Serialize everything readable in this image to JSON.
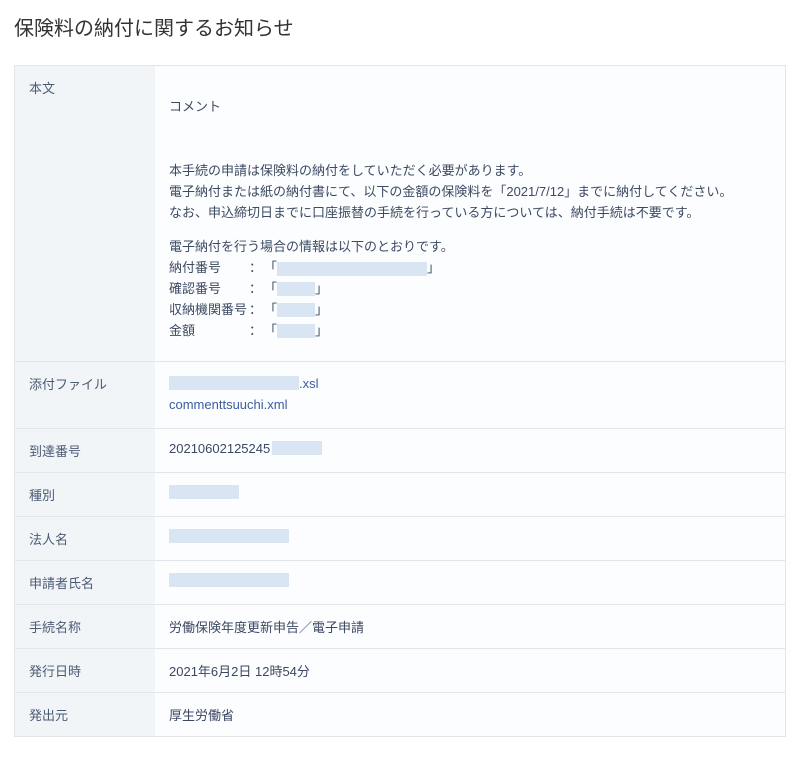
{
  "page_title": "保険料の納付に関するお知らせ",
  "labels": {
    "body": "本文",
    "attachments": "添付ファイル",
    "arrival_number": "到達番号",
    "category": "種別",
    "corporate_name": "法人名",
    "applicant_name": "申請者氏名",
    "procedure_name": "手続名称",
    "issue_datetime": "発行日時",
    "issuer": "発出元"
  },
  "body": {
    "comment_heading": "コメント",
    "paragraph1": "本手続の申請は保険料の納付をしていただく必要があります。",
    "paragraph2": "電子納付または紙の納付書にて、以下の金額の保険料を「2021/7/12」までに納付してください。",
    "paragraph3": "なお、申込締切日までに口座振替の手続を行っている方については、納付手続は不要です。",
    "info_lead": "電子納付を行う場合の情報は以下のとおりです。",
    "fields": {
      "payment_number": "納付番号",
      "confirmation_number": "確認番号",
      "agency_number": "収納機関番号",
      "amount": "金額"
    },
    "colon": "：",
    "lb": "「",
    "rb": "」"
  },
  "attachments": {
    "file1_ext": ".xsl",
    "file2": "commenttsuuchi.xml"
  },
  "values": {
    "arrival_number_prefix": "20210602125245",
    "procedure_name": "労働保険年度更新申告／電子申請",
    "issue_datetime": "2021年6月2日 12時54分",
    "issuer": "厚生労働省"
  }
}
